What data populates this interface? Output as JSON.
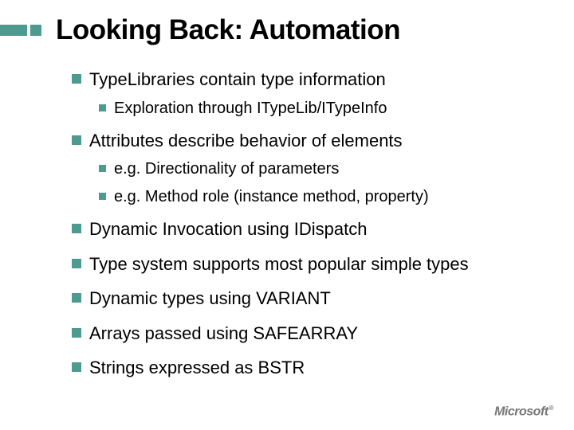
{
  "slide": {
    "title": "Looking Back: Automation"
  },
  "bullets": {
    "i0": "TypeLibraries contain type information",
    "i0_0": "Exploration through ITypeLib/ITypeInfo",
    "i1": "Attributes describe behavior of elements",
    "i1_0": "e.g. Directionality of parameters",
    "i1_1": "e.g. Method role (instance method, property)",
    "i2": "Dynamic Invocation using IDispatch",
    "i3": "Type system supports most popular simple types",
    "i4": "Dynamic types using VARIANT",
    "i5": "Arrays passed using SAFEARRAY",
    "i6": "Strings expressed as BSTR"
  },
  "footer": {
    "logo": "Microsoft"
  }
}
